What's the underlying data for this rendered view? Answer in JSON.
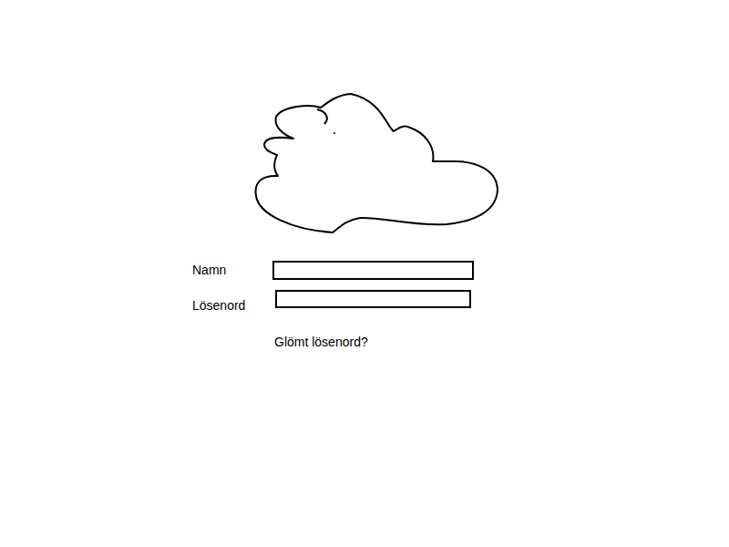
{
  "form": {
    "fields": [
      {
        "label": "Namn"
      },
      {
        "label": "Lösenord"
      }
    ]
  },
  "links": [
    {
      "label": "Glömt lösenord?"
    }
  ]
}
